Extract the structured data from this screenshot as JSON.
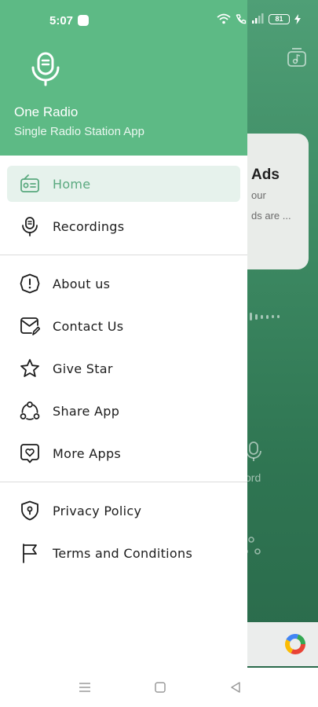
{
  "status_bar": {
    "time": "5:07",
    "battery": "81"
  },
  "background": {
    "card_title": "Ads",
    "card_line1": "our",
    "card_line2": "ds are ...",
    "record_label": "cord",
    "ad_text": "d."
  },
  "drawer": {
    "app_name": "One Radio",
    "app_tagline": "Single Radio Station App",
    "accent_color": "#5dba85",
    "items": [
      {
        "label": "Home",
        "icon": "radio-icon",
        "active": true
      },
      {
        "label": "Recordings",
        "icon": "microphone-icon",
        "active": false
      },
      {
        "label": "About us",
        "icon": "info-icon",
        "active": false
      },
      {
        "label": "Contact Us",
        "icon": "mail-edit-icon",
        "active": false
      },
      {
        "label": "Give Star",
        "icon": "star-icon",
        "active": false
      },
      {
        "label": "Share App",
        "icon": "share-icon",
        "active": false
      },
      {
        "label": "More Apps",
        "icon": "heart-box-icon",
        "active": false
      },
      {
        "label": "Privacy Policy",
        "icon": "shield-icon",
        "active": false
      },
      {
        "label": "Terms and Conditions",
        "icon": "flag-icon",
        "active": false
      }
    ]
  },
  "nav_bar": {
    "buttons": [
      "menu-nav-icon",
      "home-nav-icon",
      "back-nav-icon"
    ]
  }
}
